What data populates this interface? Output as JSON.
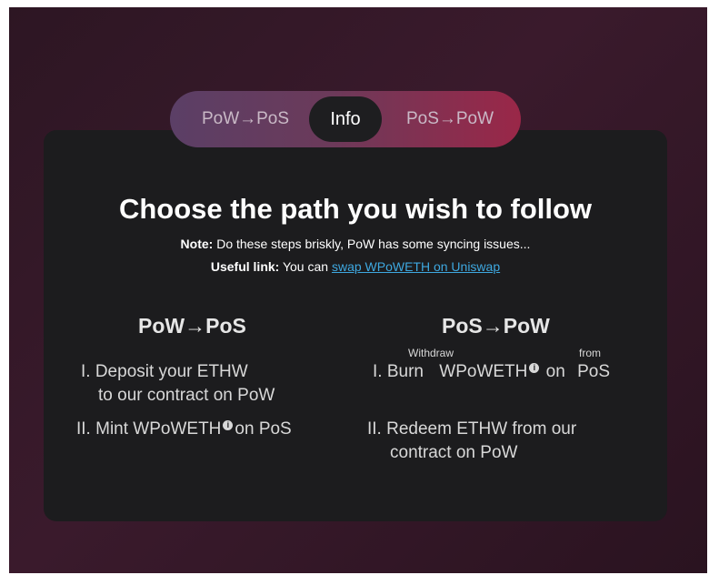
{
  "tabs": {
    "pow_to_pos": "PoW→PoS",
    "info": "Info",
    "pos_to_pow": "PoS→PoW"
  },
  "heading": "Choose the path you wish to follow",
  "note": {
    "label": "Note:",
    "text": " Do these steps briskly, PoW has some syncing issues..."
  },
  "useful_link": {
    "label": "Useful link:",
    "text": " You can ",
    "link_text": "swap WPoWETH on Uniswap"
  },
  "left_column": {
    "title": "PoW→PoS",
    "step1_line1": "I. Deposit your ETHW",
    "step1_line2": "to our contract on PoW",
    "step2_prefix": "II. Mint WPoWETH",
    "step2_suffix": "on PoS"
  },
  "right_column": {
    "title": "PoS→PoW",
    "withdraw_label": "Withdraw",
    "from_label": "from",
    "step1_prefix": "I. Burn",
    "step1_token": "WPoWETH",
    "step1_on": "on",
    "step1_chain": "PoS",
    "step2_line1": "II. Redeem ETHW from our",
    "step2_line2": "contract on PoW"
  },
  "icons": {
    "info": "info-icon"
  },
  "colors": {
    "link": "#3ea8e0",
    "card": "#1c1c1e",
    "tab_gradient_start": "#5b3f66",
    "tab_gradient_end": "#9a2748"
  }
}
